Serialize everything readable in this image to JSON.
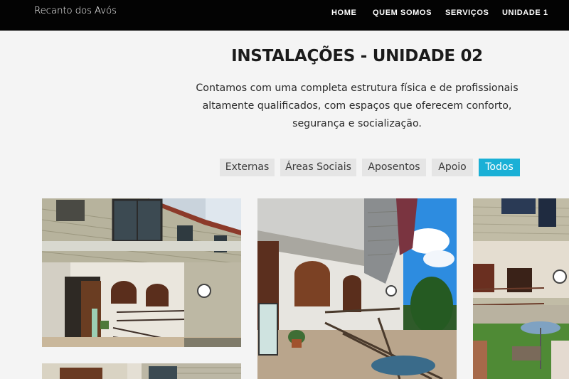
{
  "brand": {
    "logo_text": "Recanto dos Avós"
  },
  "nav": {
    "items": [
      {
        "label": "HOME"
      },
      {
        "label": "QUEM SOMOS"
      },
      {
        "label": "SERVIÇOS"
      },
      {
        "label": "UNIDADE 1"
      }
    ]
  },
  "section": {
    "title": "INSTALAÇÕES - UNIDADE 02",
    "description_lines": [
      "Contamos com uma completa estrutura física e de profissionais",
      "altamente qualificados, com espaços que oferecem conforto,",
      "segurança e socialização."
    ]
  },
  "filters": {
    "items": [
      {
        "label": "Externas",
        "active": false
      },
      {
        "label": "Áreas Sociais",
        "active": false
      },
      {
        "label": "Aposentos",
        "active": false
      },
      {
        "label": "Apoio",
        "active": false
      },
      {
        "label": "Todos",
        "active": true
      }
    ]
  },
  "colors": {
    "header_bg": "#030303",
    "accent": "#1ab0d6",
    "filter_bg": "#e5e5e5",
    "page_bg": "#f4f4f4"
  }
}
